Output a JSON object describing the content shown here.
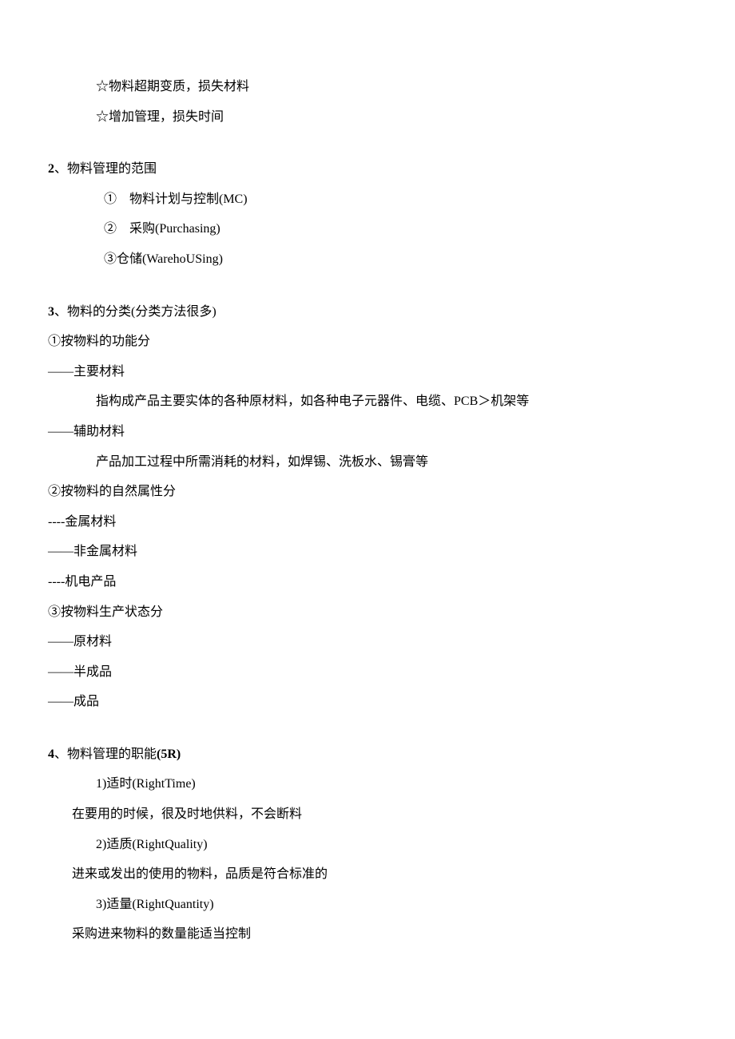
{
  "intro": {
    "l1": "☆物料超期变质，损失材料",
    "l2": "☆增加管理，损失时间"
  },
  "s2": {
    "num": "2",
    "title": "、物料管理的范围",
    "i1": "①　物料计划与控制(MC)",
    "i2": "②　采购(Purchasing)",
    "i3": "③仓储(WarehoUSing)"
  },
  "s3": {
    "num": "3",
    "title": "、物料的分类(分类方法很多)",
    "g1h": "①按物料的功能分",
    "g1a": "——主要材料",
    "g1a_d": "指构成产品主要实体的各种原材料，如各种电子元器件、电缆、PCB＞机架等",
    "g1b": "——辅助材料",
    "g1b_d": "产品加工过程中所需消耗的材料，如焊锡、洗板水、锡膏等",
    "g2h": "②按物料的自然属性分",
    "g2a": "----金属材料",
    "g2b": "——非金属材料",
    "g2c": "----机电产品",
    "g3h": "③按物料生产状态分",
    "g3a": "——原材料",
    "g3b": "——半成品",
    "g3c": "——成品"
  },
  "s4": {
    "num": "4",
    "title_a": "、物料管理的职能",
    "title_b": "(5R)",
    "r1": "1)适时(RightTime)",
    "r1d": "在要用的时候，很及时地供料，不会断料",
    "r2": "2)适质(RightQuality)",
    "r2d": "进来或发出的使用的物料，品质是符合标准的",
    "r3": "3)适量(RightQuantity)",
    "r3d": "采购进来物料的数量能适当控制"
  }
}
